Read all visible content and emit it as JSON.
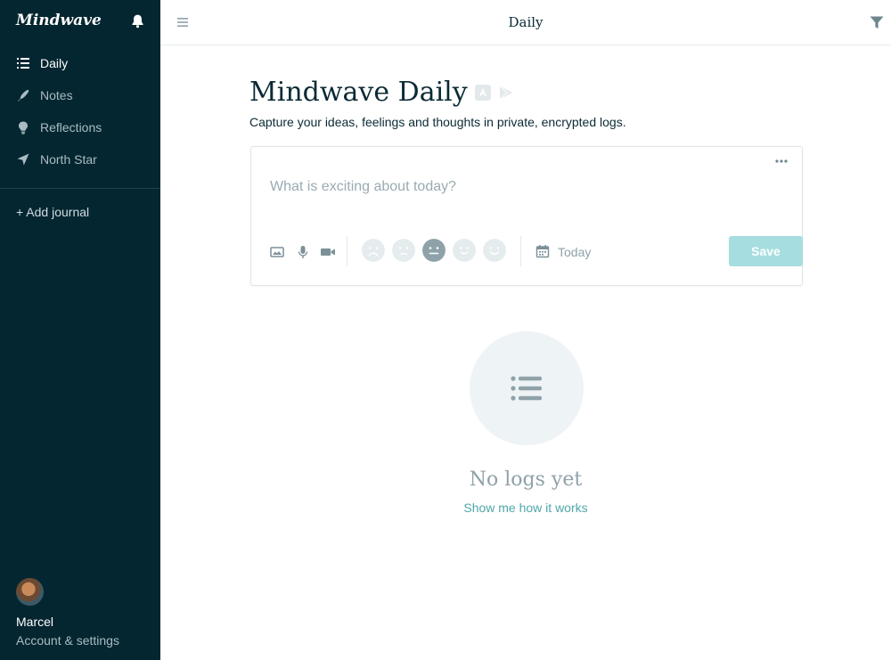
{
  "sidebar": {
    "brand": "Mindwave",
    "items": [
      {
        "label": "Daily",
        "icon": "list-icon",
        "active": true
      },
      {
        "label": "Notes",
        "icon": "pen-icon",
        "active": false
      },
      {
        "label": "Reflections",
        "icon": "lightbulb-icon",
        "active": false
      },
      {
        "label": "North Star",
        "icon": "navigation-arrow-icon",
        "active": false
      }
    ],
    "add_journal": "+ Add journal",
    "user": {
      "name": "Marcel",
      "settings": "Account & settings"
    }
  },
  "topbar": {
    "title": "Daily"
  },
  "main": {
    "title": "Mindwave Daily",
    "subtitle": "Capture your ideas, feelings and thoughts in private, encrypted logs.",
    "entry": {
      "placeholder": "What is exciting about today?",
      "date_label": "Today",
      "save_label": "Save"
    },
    "empty": {
      "title": "No logs yet",
      "link": "Show me how it works"
    }
  },
  "colors": {
    "sidebar_bg": "#042630",
    "accent": "#4fa7a9",
    "save_bg": "#a6dde0",
    "mood_selected": "#8fa2a9",
    "mood_unselected": "#e5ecee"
  }
}
